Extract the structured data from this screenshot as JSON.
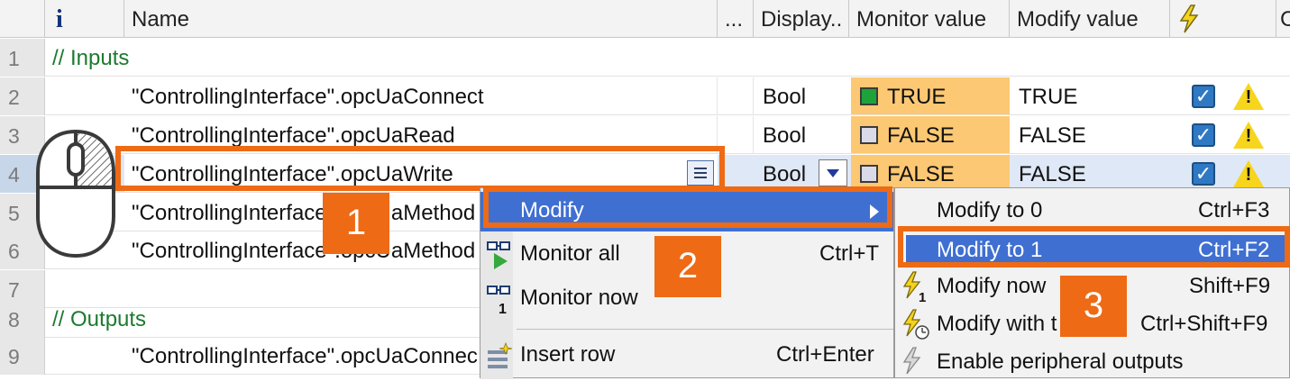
{
  "header": {
    "info": "i",
    "name": "Name",
    "more": "...",
    "display": "Display..",
    "monitor": "Monitor value",
    "modify": "Modify value",
    "last": "C"
  },
  "rows": [
    {
      "num": "1",
      "comment": "// Inputs"
    },
    {
      "num": "2",
      "name": "\"ControllingInterface\".opcUaConnect",
      "display": "Bool",
      "monitor": "TRUE",
      "monitor_on": true,
      "modify": "TRUE"
    },
    {
      "num": "3",
      "name": "\"ControllingInterface\".opcUaRead",
      "display": "Bool",
      "monitor": "FALSE",
      "modify": "FALSE"
    },
    {
      "num": "4",
      "name": "\"ControllingInterface\".opcUaWrite",
      "display": "Bool",
      "monitor": "FALSE",
      "modify": "FALSE"
    },
    {
      "num": "5",
      "name": "\"ControllingInterface\".opcUaMethod"
    },
    {
      "num": "6",
      "name": "\"ControllingInterface\".opcUaMethod"
    },
    {
      "num": "7"
    },
    {
      "num": "8",
      "comment": "// Outputs"
    },
    {
      "num": "9",
      "name": "\"ControllingInterface\".opcUaConnec"
    }
  ],
  "context_menu": {
    "modify": "Modify",
    "monitor_all": "Monitor all",
    "monitor_all_shortcut": "Ctrl+T",
    "monitor_now": "Monitor now",
    "insert_row": "Insert row",
    "insert_row_shortcut": "Ctrl+Enter"
  },
  "submenu": {
    "items": [
      {
        "label": "Modify to 0",
        "shortcut": "Ctrl+F3"
      },
      {
        "label": "Modify to 1",
        "shortcut": "Ctrl+F2"
      },
      {
        "label": "Modify now",
        "shortcut": "Shift+F9"
      },
      {
        "label": "Modify with t",
        "shortcut": "Ctrl+Shift+F9"
      },
      {
        "label": "Enable peripheral outputs",
        "shortcut": ""
      }
    ]
  },
  "badges": [
    "1",
    "2",
    "3"
  ],
  "colors": {
    "accent": "#ee6a14",
    "selection": "#3f6fd1",
    "monitor_bg": "#fcc873"
  },
  "icons": [
    "info-icon",
    "lightning-icon",
    "mouse-icon",
    "checkbox-icon",
    "warning-icon",
    "dropdown-icon",
    "list-icon",
    "glasses-icon",
    "insert-row-icon",
    "submenu-arrow-icon"
  ]
}
